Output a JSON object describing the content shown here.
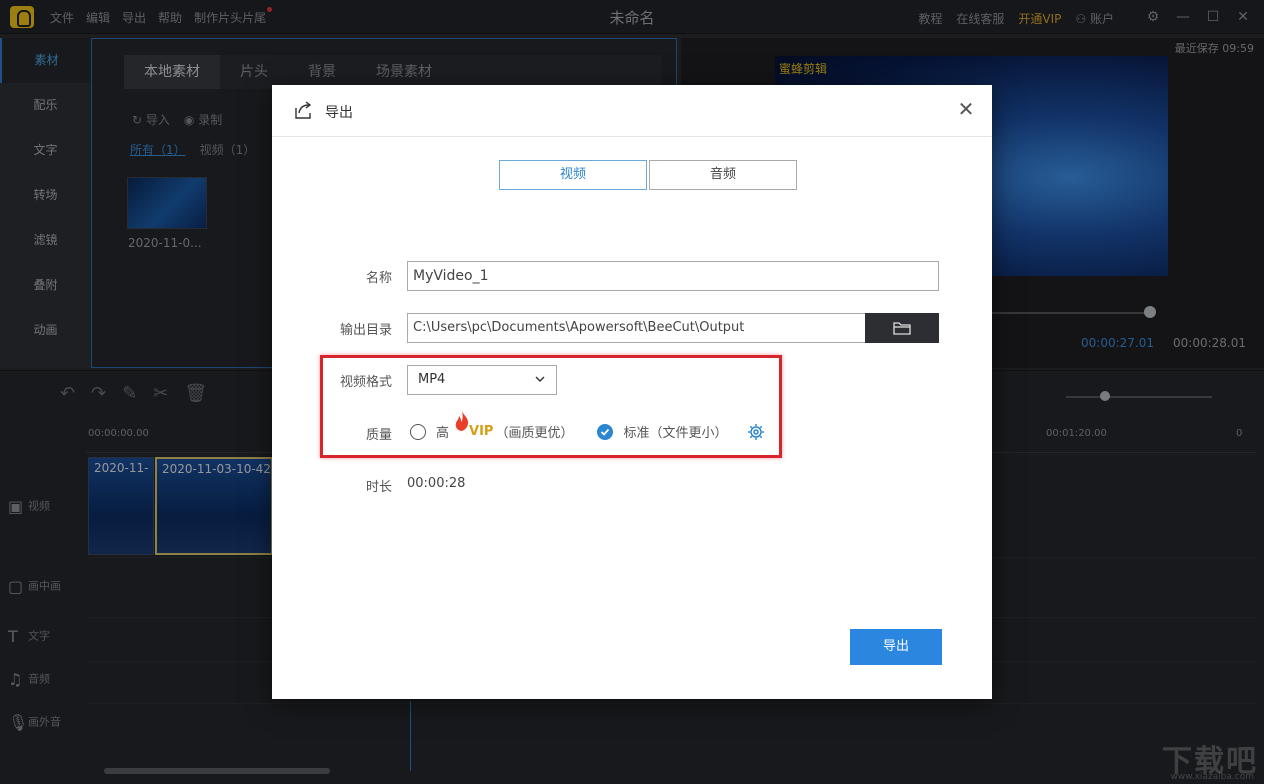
{
  "titlebar": {
    "menu": [
      "文件",
      "编辑",
      "导出",
      "帮助",
      "制作片头片尾"
    ],
    "title": "未命名",
    "right_items": [
      "教程",
      "在线客服",
      "开通VIP",
      "账户"
    ]
  },
  "sidebar": {
    "items": [
      "素材",
      "配乐",
      "文字",
      "转场",
      "滤镜",
      "叠附",
      "动画"
    ]
  },
  "media": {
    "tabs": [
      "本地素材",
      "片头",
      "背景",
      "场景素材"
    ],
    "import_label": "导入",
    "record_label": "录制",
    "filters": [
      "所有（1）",
      "视频（1）"
    ],
    "thumb_label": "2020-11-0..."
  },
  "preview": {
    "saved": "最近保存 09:59",
    "brand": "蜜蜂剪辑",
    "time_current": "00:00:27.01",
    "time_total": "00:00:28.01"
  },
  "timeline": {
    "ruler": [
      "00:00:00.00",
      "00:01:20.00",
      "0"
    ],
    "tracks": [
      "视频",
      "画中画",
      "文字",
      "音频",
      "画外音"
    ],
    "clips": [
      "2020-11-",
      "2020-11-03-10-42"
    ]
  },
  "watermark": {
    "text": "下载吧",
    "url": "www.xiazaiba.com"
  },
  "dialog": {
    "title": "导出",
    "tabs": [
      "视频",
      "音频"
    ],
    "name_label": "名称",
    "name_value": "MyVideo_1",
    "dir_label": "输出目录",
    "dir_value": "C:\\Users\\pc\\Documents\\Apowersoft\\BeeCut\\Output",
    "format_label": "视频格式",
    "format_value": "MP4",
    "quality_label": "质量",
    "quality_high": "高",
    "quality_high_vip": "VIP",
    "quality_high_desc": "（画质更优）",
    "quality_std": "标准（文件更小）",
    "duration_label": "时长",
    "duration_value": "00:00:28",
    "export_button": "导出"
  },
  "colors": {
    "accent": "#2b86e0",
    "highlight": "#d8242a",
    "vip": "#d4a017"
  }
}
